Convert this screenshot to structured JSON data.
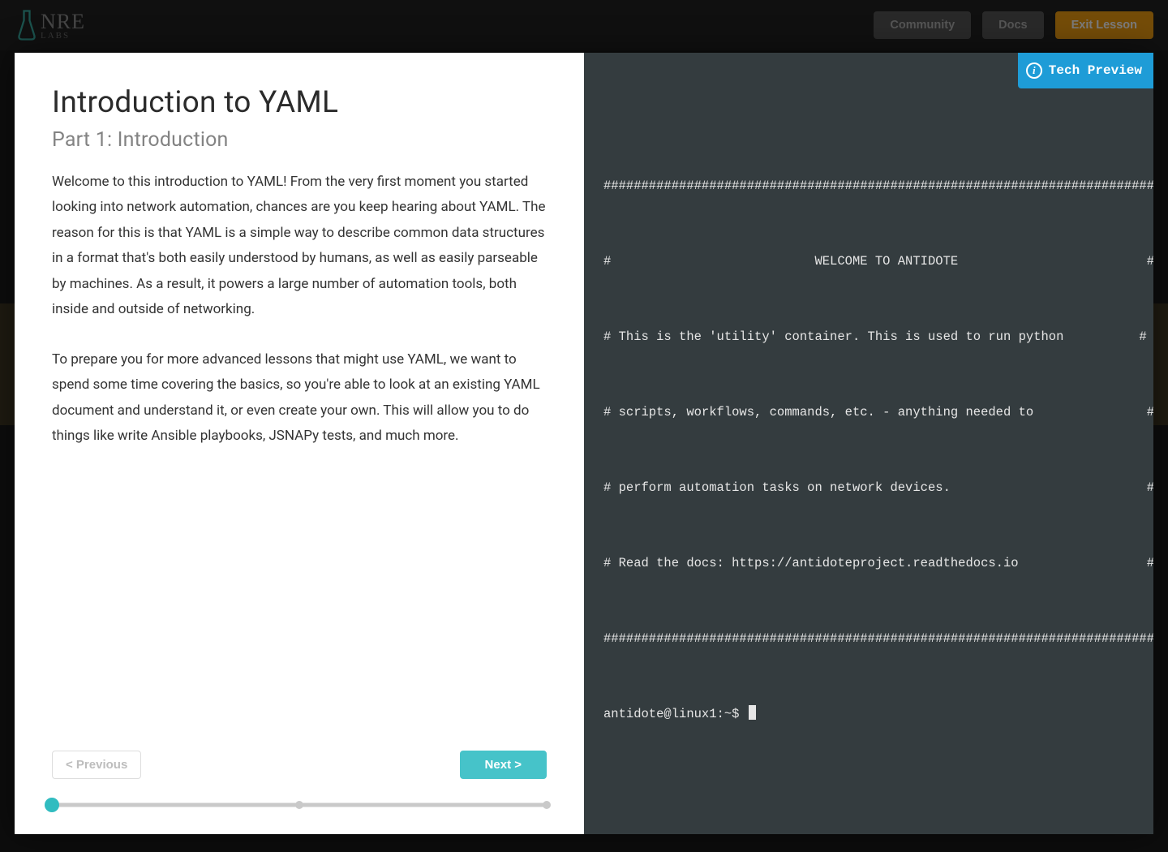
{
  "header": {
    "logo_main": "NRE",
    "logo_sub": "LABS",
    "buttons": {
      "community": "Community",
      "docs": "Docs",
      "exit": "Exit Lesson"
    }
  },
  "badge": {
    "label": "Tech Preview"
  },
  "lesson": {
    "title": "Introduction to YAML",
    "subtitle": "Part 1: Introduction",
    "para1": "Welcome to this introduction to YAML! From the very first moment you started looking into network automation, chances are you keep hearing about YAML. The reason for this is that YAML is a simple way to describe common data structures in a format that's both easily understood by humans, as well as easily parseable by machines. As a result, it powers a large number of automation tools, both inside and outside of networking.",
    "para2": "To prepare you for more advanced lessons that might use YAML, we want to spend some time covering the basics, so you're able to look at an existing YAML document and understand it, or even create your own. This will allow you to do things like write Ansible playbooks, JSNAPy tests, and much more."
  },
  "nav": {
    "prev": "< Previous",
    "next": "Next >"
  },
  "progress": {
    "steps": 3,
    "active": 0
  },
  "terminal": {
    "lines": [
      "#########################################################################",
      "#                           WELCOME TO ANTIDOTE                         #",
      "# This is the 'utility' container. This is used to run python          #",
      "# scripts, workflows, commands, etc. - anything needed to               #",
      "# perform automation tasks on network devices.                          #",
      "# Read the docs: https://antidoteproject.readthedocs.io                 #",
      "#########################################################################"
    ],
    "prompt": "antidote@linux1:~$ "
  }
}
